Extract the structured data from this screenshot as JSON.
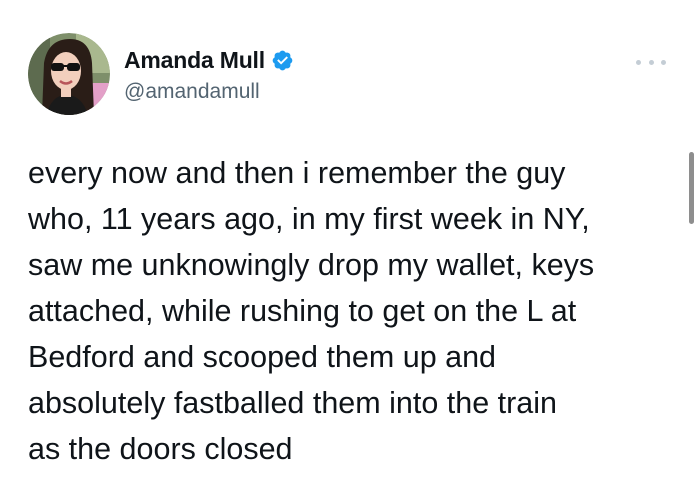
{
  "author": {
    "display_name": "Amanda Mull",
    "handle": "@amandamull",
    "verified": true,
    "verified_color": "#1d9bf0",
    "avatar_icon": "profile-photo"
  },
  "menu": {
    "more_icon": "more-horizontal-icon"
  },
  "tweet": {
    "lines": [
      "every now and then i remember the guy",
      "who, 11 years ago, in my first week in NY,",
      "saw me unknowingly drop my wallet, keys",
      "attached, while rushing to get on the L at",
      "Bedford and scooped them up and",
      "absolutely fastballed them into the train",
      "as the doors closed"
    ]
  }
}
